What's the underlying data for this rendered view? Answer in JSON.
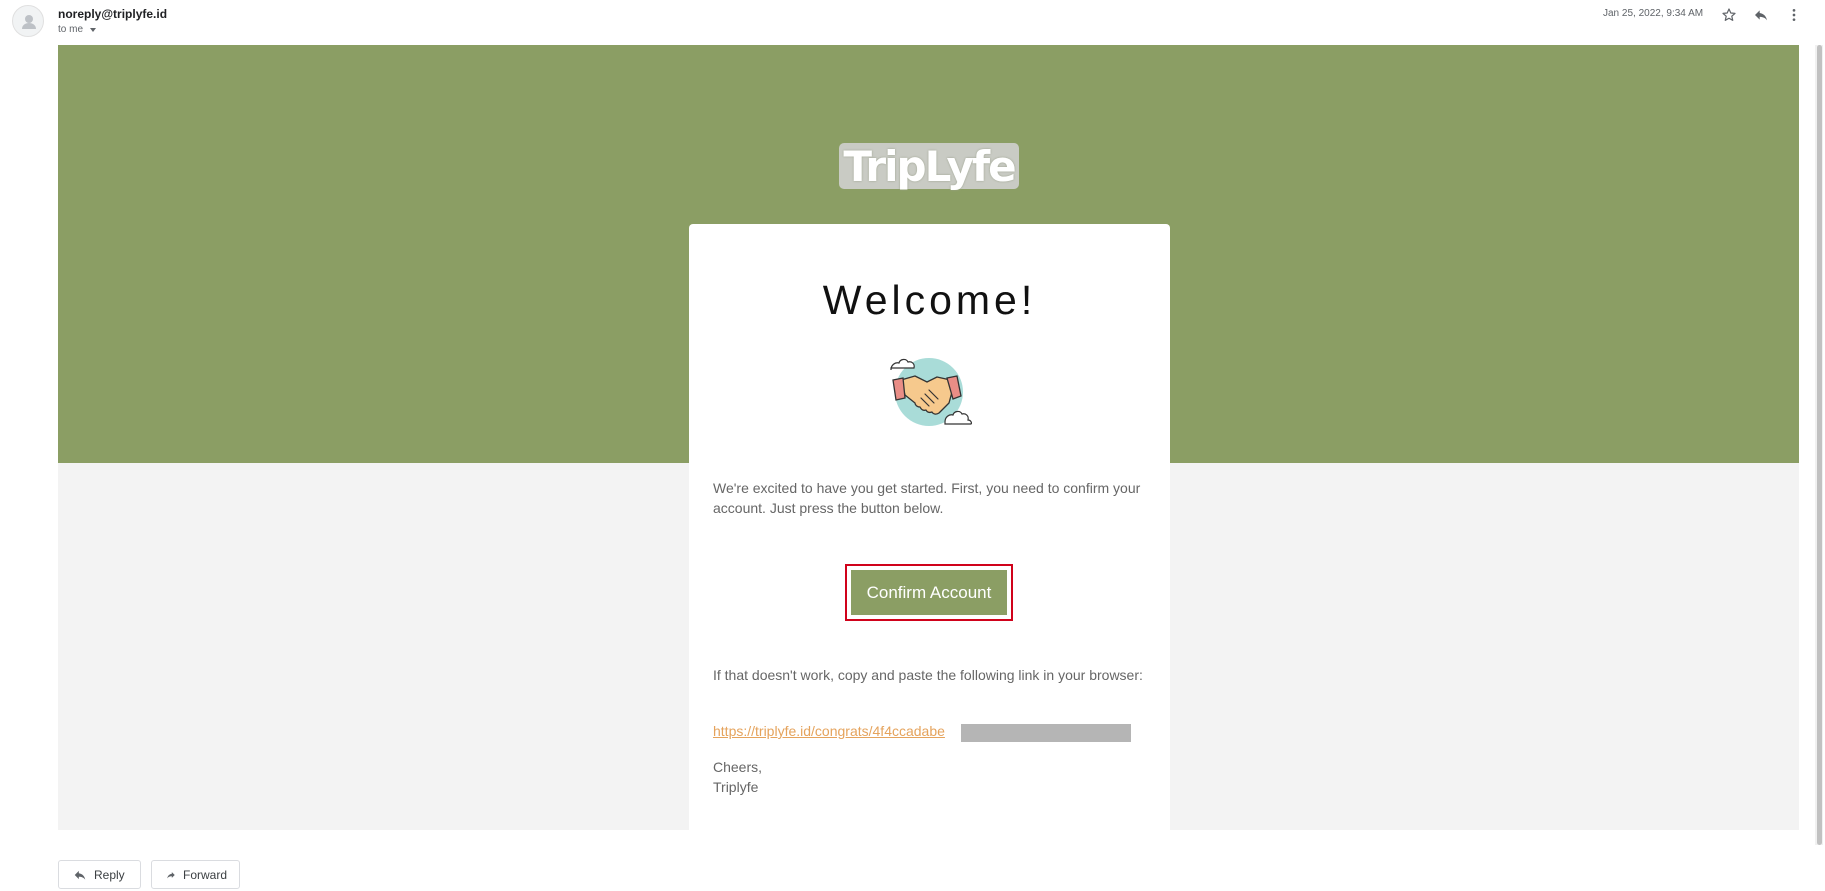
{
  "header": {
    "sender": "noreply@triplyfe.id",
    "recipient": "to me",
    "date": "Jan 25, 2022, 9:34 AM",
    "icons": [
      "person-icon",
      "star-icon",
      "reply-icon",
      "more-vert-icon"
    ]
  },
  "email": {
    "logo_text": "TripLyfe",
    "welcome": "Welcome!",
    "intro": "We're excited to have you get started. First, you need to confirm your account. Just press the button below.",
    "button_label": "Confirm Account",
    "fallback_text": "If that doesn't work, copy and paste the following link in your browser:",
    "link_text": "https://triplyfe.id/congrats/4f4ccadabe",
    "sign_off": "Cheers,",
    "signature": "Triplyfe",
    "colors": {
      "brand_green": "#8b9e64",
      "link": "#e5a35c",
      "highlight": "#d0021b",
      "background": "#f3f3f3"
    }
  },
  "footer": {
    "reply_label": "Reply",
    "forward_label": "Forward"
  }
}
